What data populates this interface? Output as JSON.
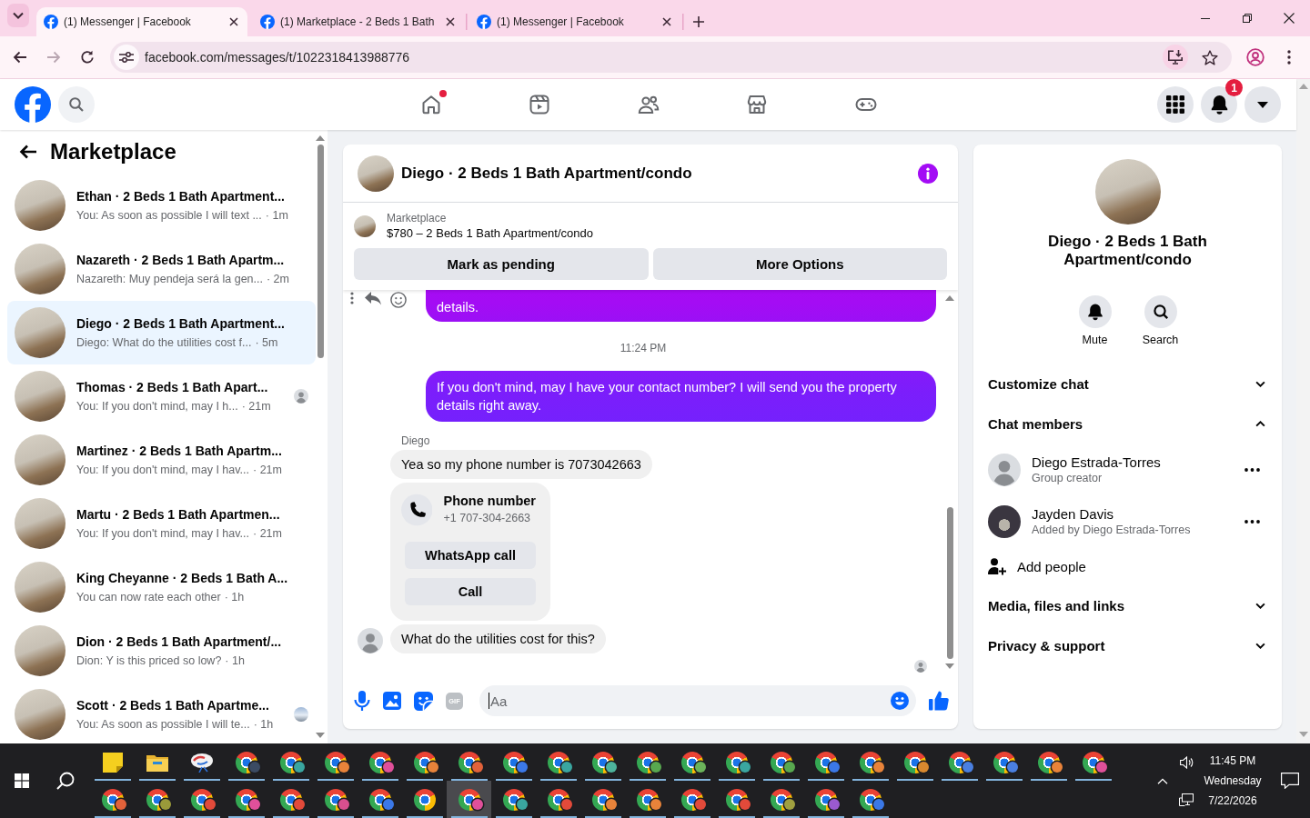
{
  "browser": {
    "tabs": [
      {
        "title": "(1) Messenger | Facebook",
        "selected": true
      },
      {
        "title": "(1) Marketplace - 2 Beds 1 Bath",
        "selected": false
      },
      {
        "title": "(1) Messenger | Facebook",
        "selected": false
      }
    ],
    "url": "facebook.com/messages/t/1022318413988776",
    "can_go_forward": false
  },
  "header": {
    "nav": [
      {
        "kind": "home",
        "dot": true
      },
      {
        "kind": "video",
        "dot": false
      },
      {
        "kind": "friends",
        "dot": false
      },
      {
        "kind": "marketplace",
        "dot": false
      },
      {
        "kind": "gaming",
        "dot": false
      }
    ],
    "notification_count": "1"
  },
  "sidebar": {
    "title": "Marketplace",
    "conversations": [
      {
        "name": "Ethan · 2 Beds 1 Bath Apartment...",
        "preview": "You: As soon as possible I will text ...",
        "time": "· 1m",
        "selected": false,
        "seen": false
      },
      {
        "name": "Nazareth · 2 Beds 1 Bath Apartm...",
        "preview": "Nazareth: Muy pendeja será la gen...",
        "time": "· 2m",
        "selected": false,
        "seen": false
      },
      {
        "name": "Diego · 2 Beds 1 Bath Apartment...",
        "preview": "Diego: What do the utilities cost f...",
        "time": "· 5m",
        "selected": true,
        "seen": false
      },
      {
        "name": "Thomas · 2 Beds 1 Bath Apart...",
        "preview": "You: If you don't mind, may I h...",
        "time": "· 21m",
        "selected": false,
        "seen": true,
        "reader": {
          "photo": false
        }
      },
      {
        "name": "Martinez · 2 Beds 1 Bath Apartm...",
        "preview": "You: If you don't mind, may I hav...",
        "time": "· 21m",
        "selected": false,
        "seen": false
      },
      {
        "name": "Martu · 2 Beds 1 Bath Apartmen...",
        "preview": "You: If you don't mind, may I hav...",
        "time": "· 21m",
        "selected": false,
        "seen": false
      },
      {
        "name": "King Cheyanne · 2 Beds 1 Bath A...",
        "preview": "You can now rate each other",
        "time": "· 1h",
        "selected": false,
        "seen": false
      },
      {
        "name": "Dion · 2 Beds 1 Bath Apartment/...",
        "preview": "Dion: Y is this priced so low?",
        "time": "· 1h",
        "selected": false,
        "seen": false
      },
      {
        "name": "Scott · 2 Beds 1 Bath Apartme...",
        "preview": "You: As soon as possible I will te...",
        "time": "· 1h",
        "selected": false,
        "seen": true,
        "reader": {
          "photo": true
        }
      }
    ]
  },
  "chat": {
    "title": "Diego · 2 Beds 1 Bath Apartment/condo",
    "listing": {
      "label": "Marketplace",
      "summary": "$780 – 2 Beds 1 Bath Apartment/condo",
      "buttons": [
        "Mark as pending",
        "More Options"
      ]
    },
    "messages": [
      {
        "kind": "outgoing",
        "text": "details.",
        "hovered": true
      },
      {
        "kind": "time",
        "text": "11:24 PM"
      },
      {
        "kind": "outgoing",
        "text": "If you don't mind, may I have your contact number? I will send you the property details right away.",
        "hovered": false
      },
      {
        "kind": "group",
        "sender": "Diego",
        "items": [
          {
            "kind": "text",
            "text": "Yea so my phone number is 7073042663"
          },
          {
            "kind": "phone",
            "title": "Phone number",
            "number": "+1 707-304-2663",
            "buttons": [
              "WhatsApp call",
              "Call"
            ]
          },
          {
            "kind": "text",
            "text": "What do the utilities cost for this?"
          }
        ]
      }
    ],
    "seen": true,
    "composer": {
      "placeholder": "Aa",
      "gif_label": "GIF"
    }
  },
  "details": {
    "title": "Diego · 2 Beds 1 Bath Apartment/condo",
    "actions": [
      {
        "kind": "mute",
        "label": "Mute"
      },
      {
        "kind": "search",
        "label": "Search"
      }
    ],
    "sections": [
      {
        "title": "Customize chat",
        "expanded": false
      },
      {
        "title": "Chat members",
        "expanded": true,
        "members": [
          {
            "name": "Diego Estrada-Torres",
            "role": "Group creator",
            "photo": false
          },
          {
            "name": "Jayden Davis",
            "role": "Added by Diego Estrada-Torres",
            "photo": true
          }
        ],
        "add_label": "Add people"
      },
      {
        "title": "Media, files and links",
        "expanded": false
      },
      {
        "title": "Privacy & support",
        "expanded": false
      }
    ]
  },
  "taskbar": {
    "rows": [
      [
        {
          "kind": "sticky-notes",
          "selected": false
        },
        {
          "kind": "file-explorer",
          "selected": false
        },
        {
          "kind": "app",
          "selected": false
        },
        {
          "kind": "chrome",
          "color": "#3b4b63",
          "selected": false
        },
        {
          "kind": "chrome",
          "color": "#3aa6a0",
          "selected": false
        },
        {
          "kind": "chrome",
          "color": "#e8833a",
          "selected": false
        },
        {
          "kind": "chrome",
          "color": "#e0509a",
          "selected": false
        },
        {
          "kind": "chrome",
          "color": "#e8833a",
          "selected": false
        },
        {
          "kind": "chrome",
          "color": "#e2623a",
          "selected": false
        },
        {
          "kind": "chrome",
          "color": "#3b78e7",
          "selected": false
        },
        {
          "kind": "chrome",
          "color": "#3aa6a0",
          "selected": false
        },
        {
          "kind": "chrome",
          "color": "#4db39c",
          "selected": false
        },
        {
          "kind": "chrome",
          "color": "#58a84f",
          "selected": false
        },
        {
          "kind": "chrome",
          "color": "#6bb35a",
          "selected": false
        },
        {
          "kind": "chrome",
          "color": "#3aa6a0",
          "selected": false
        },
        {
          "kind": "chrome",
          "color": "#58a84f",
          "selected": false
        },
        {
          "kind": "chrome",
          "color": "#3b78e7",
          "selected": false
        },
        {
          "kind": "chrome",
          "color": "#e8833a",
          "selected": false
        },
        {
          "kind": "chrome",
          "color": "#d9892f",
          "selected": false
        },
        {
          "kind": "chrome",
          "color": "#4a7fe0",
          "selected": false
        },
        {
          "kind": "chrome",
          "color": "#4a7fe0",
          "selected": false
        },
        {
          "kind": "chrome",
          "color": "#e8833a",
          "selected": false
        },
        {
          "kind": "chrome",
          "color": "#e0509a",
          "selected": false
        }
      ],
      [
        {
          "kind": "chrome",
          "color": "#e2623a",
          "selected": false
        },
        {
          "kind": "chrome",
          "color": "#9a9a3a",
          "selected": false
        },
        {
          "kind": "chrome",
          "color": "#e24a3a",
          "selected": false
        },
        {
          "kind": "chrome",
          "color": "#e0509a",
          "selected": false
        },
        {
          "kind": "chrome",
          "color": "#e24a3a",
          "selected": false
        },
        {
          "kind": "chrome",
          "color": "#d94f8f",
          "selected": false
        },
        {
          "kind": "chrome",
          "color": "#3b78e7",
          "selected": false
        },
        {
          "kind": "chrome-plain",
          "selected": false
        },
        {
          "kind": "chrome",
          "color": "#e0509a",
          "selected": true
        },
        {
          "kind": "chrome",
          "color": "#3aa6a0",
          "selected": false
        },
        {
          "kind": "chrome",
          "color": "#e24a3a",
          "selected": false
        },
        {
          "kind": "chrome",
          "color": "#e8833a",
          "selected": false
        },
        {
          "kind": "chrome",
          "color": "#e8833a",
          "selected": false
        },
        {
          "kind": "chrome",
          "color": "#e24a3a",
          "selected": false
        },
        {
          "kind": "chrome",
          "color": "#e24a3a",
          "selected": false
        },
        {
          "kind": "chrome",
          "color": "#a0a040",
          "selected": false
        },
        {
          "kind": "chrome",
          "color": "#9a5ad0",
          "selected": false
        },
        {
          "kind": "chrome",
          "color": "#3b78e7",
          "selected": false
        }
      ]
    ],
    "clock": {
      "time": "11:45 PM",
      "day": "Wednesday",
      "date": "7/22/2026"
    }
  }
}
